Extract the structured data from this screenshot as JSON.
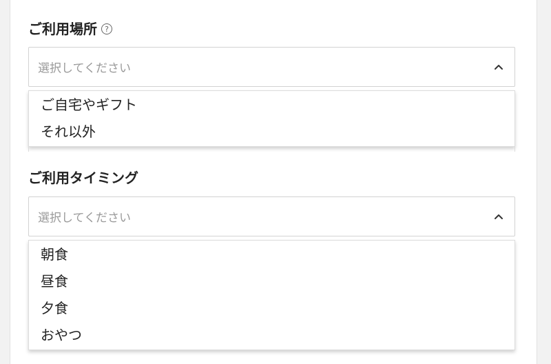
{
  "location": {
    "label": "ご利用場所",
    "help_icon": "question-circle-icon",
    "help_glyph": "?",
    "placeholder": "選択してください",
    "chevron_icon": "chevron-up-icon",
    "options": [
      "ご自宅やギフト",
      "それ以外"
    ]
  },
  "timing": {
    "label": "ご利用タイミング",
    "placeholder": "選択してください",
    "chevron_icon": "chevron-up-icon",
    "options": [
      "朝食",
      "昼食",
      "夕食",
      "おやつ"
    ]
  },
  "colors": {
    "background": "#f2f2f2",
    "card": "#ffffff",
    "text": "#222222",
    "placeholder": "#9a9a9a",
    "border": "#d2d2d2"
  }
}
